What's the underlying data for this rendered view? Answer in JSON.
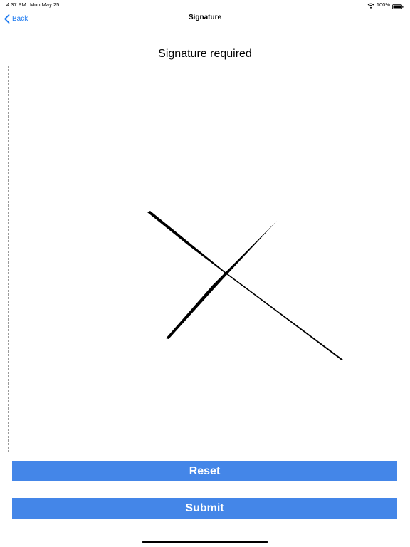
{
  "status_bar": {
    "time": "4:37 PM",
    "date": "Mon May 25",
    "battery": "100%",
    "icons": [
      "wifi-icon",
      "battery-icon"
    ]
  },
  "nav": {
    "back_label": "Back",
    "title": "Signature",
    "back_icon": "chevron-left-icon",
    "accent_color": "#1f7bf0"
  },
  "signature": {
    "heading": "Signature required",
    "stroke_color": "#000000"
  },
  "buttons": {
    "reset_label": "Reset",
    "submit_label": "Submit",
    "color": "#4486e8"
  }
}
